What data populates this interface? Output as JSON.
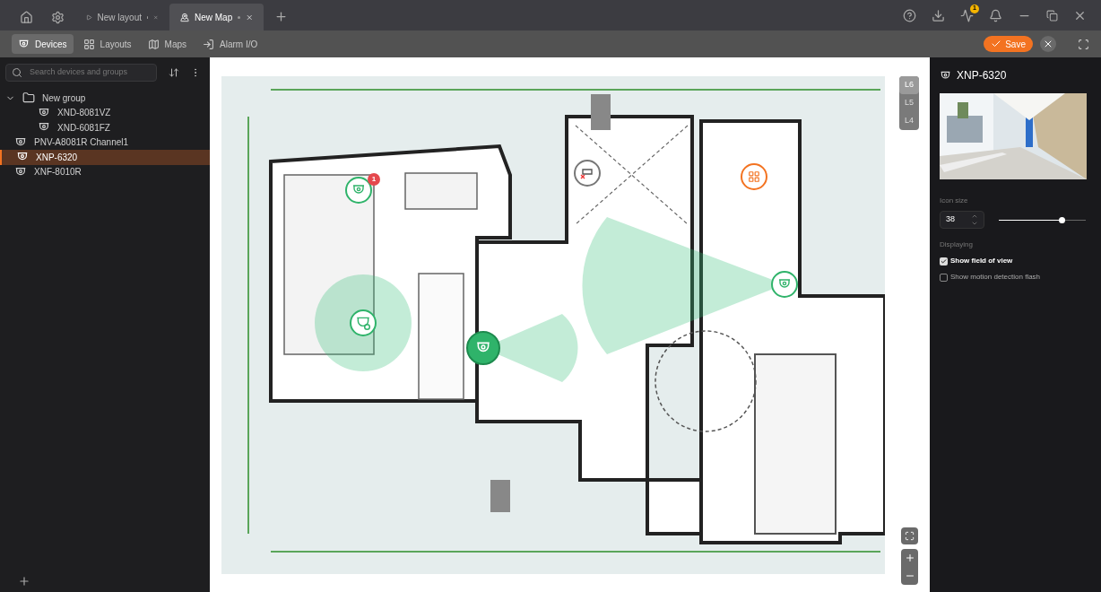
{
  "title_bar": {
    "tabs": [
      {
        "label": "New layout",
        "kind": "layout",
        "unsaved": true,
        "selected": false
      },
      {
        "label": "New Map",
        "kind": "map",
        "unsaved": true,
        "selected": true
      }
    ],
    "notification_badge": "1"
  },
  "toolbar": {
    "tabs": [
      {
        "label": "Devices",
        "kind": "devices",
        "selected": true
      },
      {
        "label": "Layouts",
        "kind": "layouts",
        "selected": false
      },
      {
        "label": "Maps",
        "kind": "maps",
        "selected": false
      },
      {
        "label": "Alarm I/O",
        "kind": "alarm",
        "selected": false
      }
    ],
    "save": "Save"
  },
  "sidebar": {
    "search": {
      "placeholder": "Search devices and groups"
    },
    "tree": [
      {
        "label": "New group",
        "kind": "group",
        "expanded": true,
        "selected": false,
        "children": [
          {
            "label": "XND-8081VZ",
            "kind": "dome",
            "selected": false
          },
          {
            "label": "XND-6081FZ",
            "kind": "dome",
            "selected": false
          }
        ]
      },
      {
        "label": "PNV-A8081R Channel1",
        "kind": "dome",
        "selected": false
      },
      {
        "label": "XNP-6320",
        "kind": "ptz",
        "selected": true
      },
      {
        "label": "XNF-8010R",
        "kind": "fisheye",
        "selected": false
      }
    ]
  },
  "map": {
    "floors": [
      {
        "label": "L6",
        "selected": true
      },
      {
        "label": "L5",
        "selected": false
      },
      {
        "label": "L4",
        "selected": false
      }
    ],
    "markers": [
      {
        "kind": "dome",
        "badge": "1",
        "selected": false,
        "fov": false
      },
      {
        "kind": "ptz",
        "selected": false,
        "fov": true
      },
      {
        "kind": "dome",
        "selected": true,
        "fov": true
      },
      {
        "kind": "dome",
        "selected": false,
        "fov": true
      },
      {
        "kind": "offline",
        "selected": false,
        "fov": false
      },
      {
        "kind": "sensor",
        "selected": false,
        "fov": false
      }
    ]
  },
  "properties": {
    "title": "XNP-6320",
    "icon_size": {
      "label": "Icon size",
      "value": "38",
      "level": 0.73
    },
    "displaying": {
      "label": "Displaying",
      "options": [
        {
          "label": "Show field of view",
          "checked": true
        },
        {
          "label": "Show motion detection flash",
          "checked": false
        }
      ]
    }
  }
}
